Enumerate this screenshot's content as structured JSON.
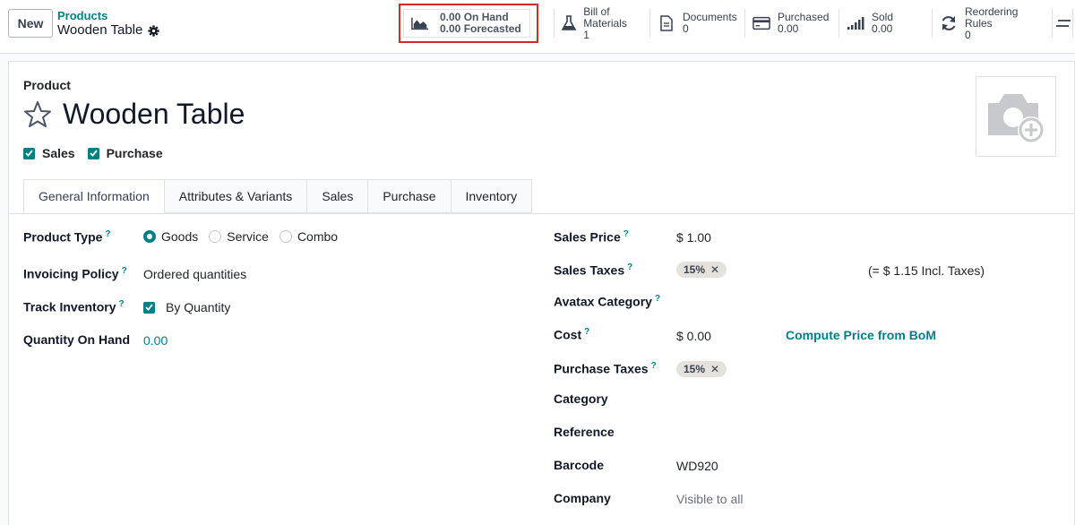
{
  "topbar": {
    "new_label": "New",
    "breadcrumb_parent": "Products",
    "breadcrumb_current": "Wooden Table"
  },
  "stats": {
    "onhand": {
      "line1": "0.00 On Hand",
      "line2": "0.00 Forecasted"
    },
    "bom": {
      "label": "Bill of Materials",
      "value": "1"
    },
    "documents": {
      "label": "Documents",
      "value": "0"
    },
    "purchased": {
      "label": "Purchased",
      "value": "0.00"
    },
    "sold": {
      "label": "Sold",
      "value": "0.00"
    },
    "reordering": {
      "label": "Reordering Rules",
      "value": "0"
    }
  },
  "form": {
    "section_label": "Product",
    "product_name": "Wooden Table",
    "can_be_sold": "Sales",
    "can_be_purchased": "Purchase"
  },
  "tabs": [
    "General Information",
    "Attributes & Variants",
    "Sales",
    "Purchase",
    "Inventory"
  ],
  "left": {
    "product_type_label": "Product Type",
    "product_type_options": [
      "Goods",
      "Service",
      "Combo"
    ],
    "invoicing_label": "Invoicing Policy",
    "invoicing_value": "Ordered quantities",
    "track_label": "Track Inventory",
    "track_value": "By Quantity",
    "qty_label": "Quantity On Hand",
    "qty_value": "0.00"
  },
  "right": {
    "sales_price_label": "Sales Price",
    "sales_price_value": "$ 1.00",
    "sales_taxes_label": "Sales Taxes",
    "sales_tax_tag": "15%",
    "incl_taxes": "(= $ 1.15 Incl. Taxes)",
    "avatax_label": "Avatax Category",
    "cost_label": "Cost",
    "cost_value": "$ 0.00",
    "compute_bom": "Compute Price from BoM",
    "purchase_taxes_label": "Purchase Taxes",
    "purchase_tax_tag": "15%",
    "category_label": "Category",
    "reference_label": "Reference",
    "barcode_label": "Barcode",
    "barcode_value": "WD920",
    "company_label": "Company",
    "company_value": "Visible to all"
  },
  "help_mark": "?",
  "accent_color": "#017e84"
}
